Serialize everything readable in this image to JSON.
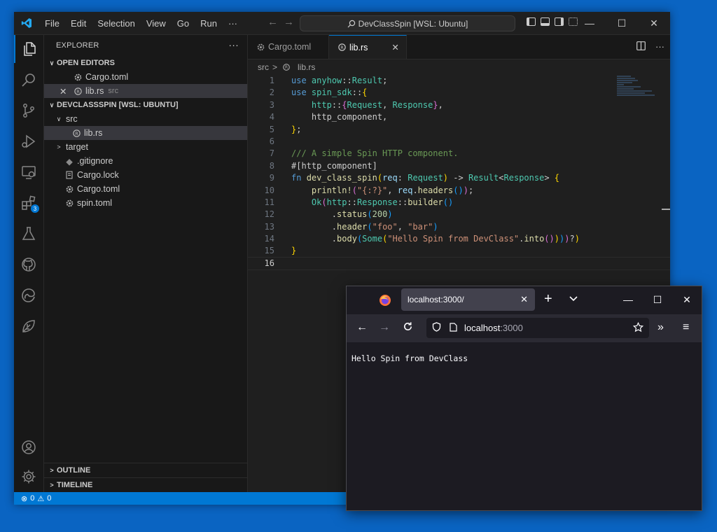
{
  "vscode": {
    "menu": [
      "File",
      "Edit",
      "Selection",
      "View",
      "Go",
      "Run",
      "···"
    ],
    "command_center": "DevClassSpin [WSL: Ubuntu]",
    "window_controls": [
      "—",
      "☐",
      "✕"
    ],
    "activity_badge": "3",
    "sidebar": {
      "title": "EXPLORER",
      "more": "···",
      "open_editors_label": "OPEN EDITORS",
      "open_editors": [
        {
          "name": "Cargo.toml",
          "desc": ""
        },
        {
          "name": "lib.rs",
          "desc": "src"
        }
      ],
      "workspace_label": "DEVCLASSSPIN [WSL: UBUNTU]",
      "tree": {
        "src": "src",
        "lib": "lib.rs",
        "target": "target",
        "gitignore": ".gitignore",
        "cargo_lock": "Cargo.lock",
        "cargo_toml": "Cargo.toml",
        "spin_toml": "spin.toml"
      },
      "outline_label": "OUTLINE",
      "timeline_label": "TIMELINE"
    },
    "tabs": [
      {
        "label": "Cargo.toml"
      },
      {
        "label": "lib.rs",
        "close": "✕"
      }
    ],
    "breadcrumb": {
      "folder": "src",
      "file": "lib.rs"
    },
    "line_numbers": [
      "1",
      "2",
      "3",
      "4",
      "5",
      "6",
      "7",
      "8",
      "9",
      "10",
      "11",
      "12",
      "13",
      "14",
      "15",
      "16"
    ],
    "status": {
      "errors": "0",
      "warnings": "0"
    },
    "accent": "#0078d4"
  },
  "firefox": {
    "tab_title": "localhost:3000/",
    "url_host": "localhost",
    "url_rest": ":3000",
    "page_text": "Hello Spin from DevClass"
  }
}
